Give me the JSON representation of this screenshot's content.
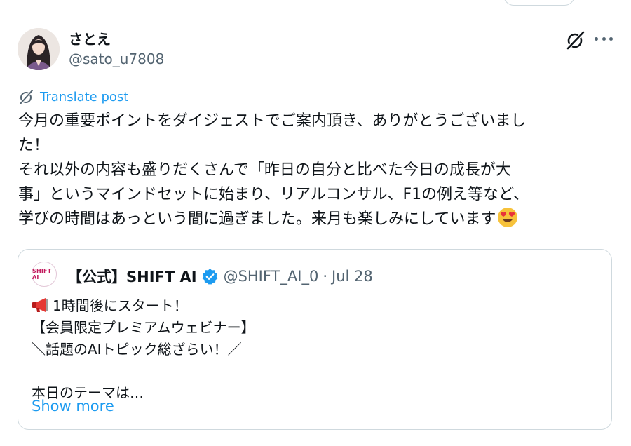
{
  "post": {
    "author": {
      "display_name": "さとえ",
      "handle": "@sato_u7808"
    },
    "translate_label": "Translate post",
    "body": "今月の重要ポイントをダイジェストでご案内頂き、ありがとうございまし\nた！\nそれ以外の内容も盛りだくさんで「昨日の自分と比べた今日の成長が大\n事」というマインドセットに始まり、リアルコンサル、F1の例え等など、\n学びの時間はあっという間に過ぎました。来月も楽しみにしています",
    "emoji": "heart-eyes-face",
    "icons": [
      "grok-icon",
      "more-icon",
      "translate-icon"
    ]
  },
  "quote": {
    "avatar_text": "SHIFT AI",
    "name": "【公式】SHIFT AI",
    "verified": true,
    "handle": "@SHIFT_AI_0",
    "separator": "·",
    "date": "Jul 28",
    "text": "1時間後にスタート！\n【会員限定プレミアムウェビナー】\n＼話題のAIトピック総ざらい！／\n\n本日のテーマは…",
    "show_more": "Show more"
  },
  "colors": {
    "accent": "#1d9bf0",
    "text": "#0f1419",
    "muted": "#536471",
    "border": "#cfd9de"
  }
}
